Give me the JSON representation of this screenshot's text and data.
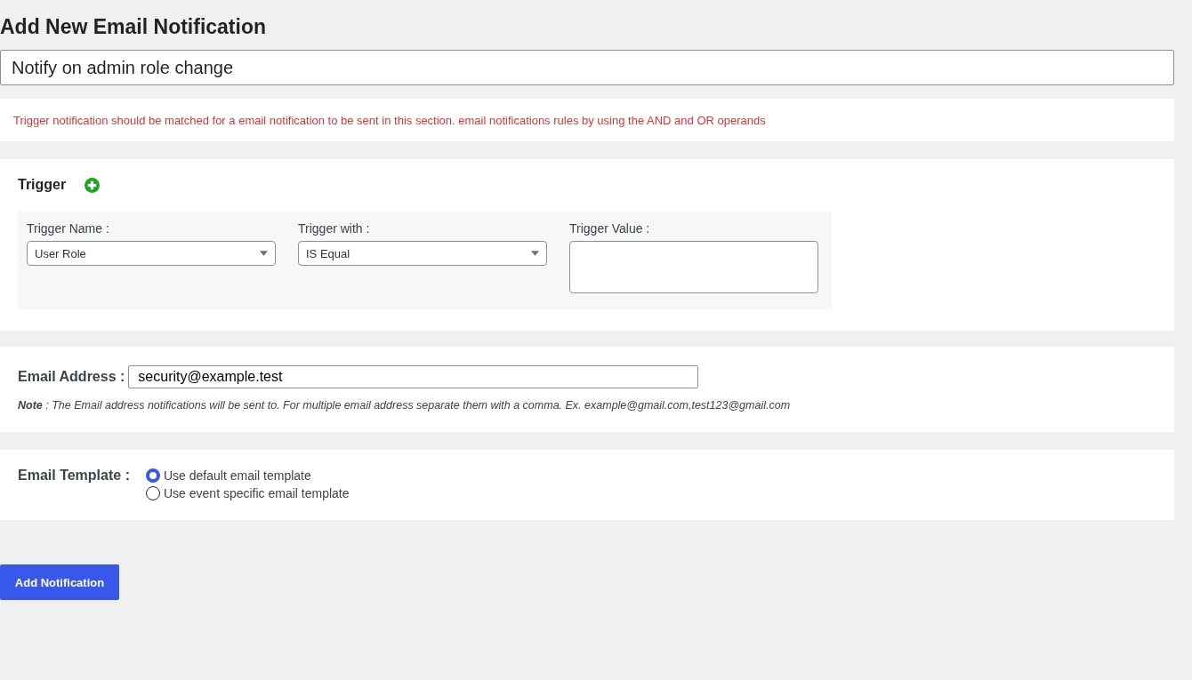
{
  "heading": "Add New Email Notification",
  "title_field": {
    "value": "Notify on admin role change"
  },
  "notice": "Trigger notification should be matched for a email notification to be sent in this section. email notifications rules by using the AND and OR operands",
  "trigger_section": {
    "title": "Trigger",
    "fields": [
      {
        "kind": "select",
        "label": "Trigger Name :",
        "value": "User Role"
      },
      {
        "kind": "select",
        "label": "Trigger with :",
        "value": "IS Equal"
      },
      {
        "kind": "textarea",
        "label": "Trigger Value :"
      }
    ]
  },
  "email_section": {
    "label": "Email Address :",
    "value": "security@example.test",
    "note": "**Note** : The Email address notifications will be sent to. For multiple email address separate them with a comma. Ex. example@gmail.com,test123@gmail.com"
  },
  "template_section": {
    "label": "Email Template :",
    "options": [
      {
        "label": "Use default email template",
        "selected": true
      },
      {
        "label": "Use event specific email template",
        "selected": false
      }
    ]
  },
  "submit_button": "Add Notification"
}
